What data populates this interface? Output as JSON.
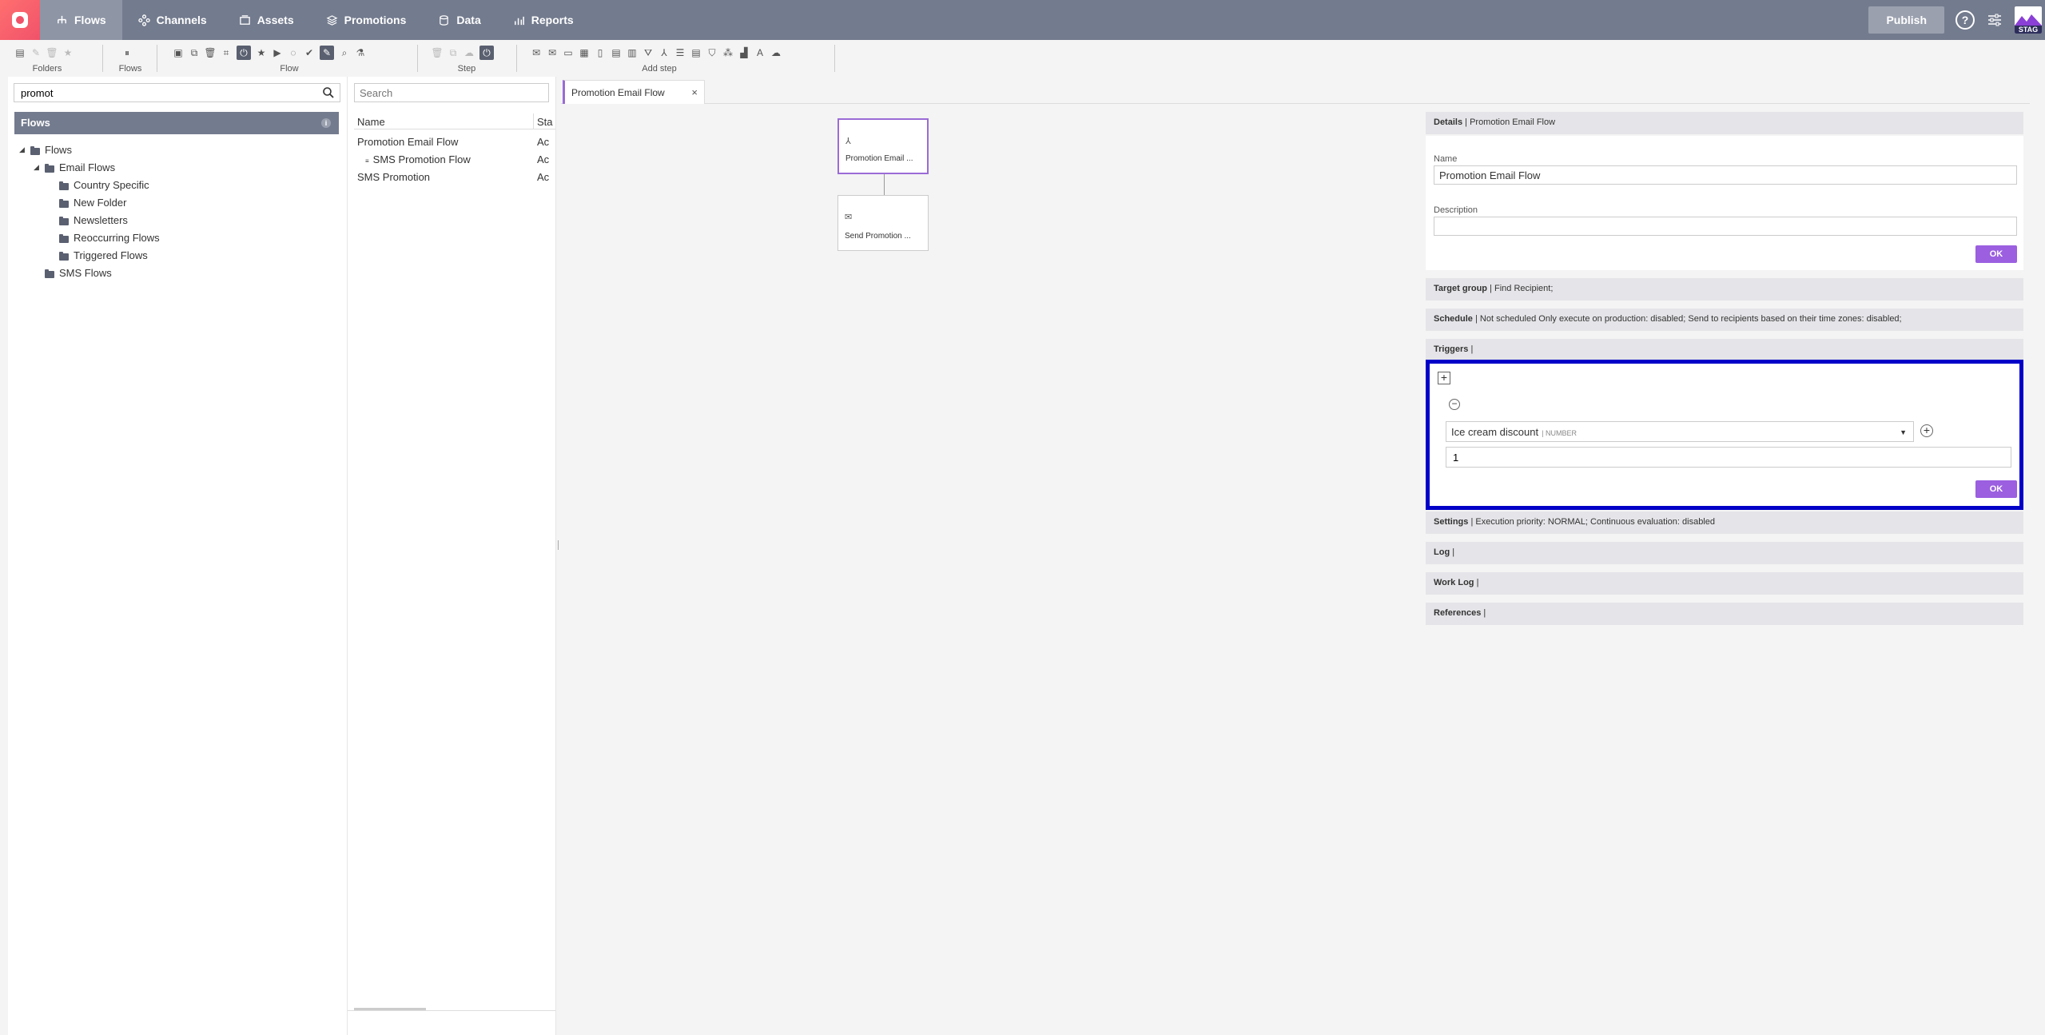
{
  "nav": {
    "items": [
      {
        "label": "Flows",
        "icon": "flows-icon"
      },
      {
        "label": "Channels",
        "icon": "channels-icon"
      },
      {
        "label": "Assets",
        "icon": "assets-icon"
      },
      {
        "label": "Promotions",
        "icon": "promotions-icon"
      },
      {
        "label": "Data",
        "icon": "data-icon"
      },
      {
        "label": "Reports",
        "icon": "reports-icon"
      }
    ],
    "publish_label": "Publish",
    "help_label": "?",
    "env_label": "STAG",
    "accent": "#737b8e"
  },
  "toolbar": {
    "groups": [
      {
        "label": "Folders"
      },
      {
        "label": "Flows"
      },
      {
        "label": "Flow"
      },
      {
        "label": "Step"
      },
      {
        "label": "Add step"
      }
    ]
  },
  "tree": {
    "search_value": "promot",
    "header": "Flows",
    "info_label": "i",
    "nodes": [
      {
        "label": "Flows"
      },
      {
        "label": "Email Flows"
      },
      {
        "label": "Country Specific"
      },
      {
        "label": "New Folder"
      },
      {
        "label": "Newsletters"
      },
      {
        "label": "Reoccurring Flows"
      },
      {
        "label": "Triggered Flows"
      },
      {
        "label": "SMS Flows"
      }
    ]
  },
  "list": {
    "search_placeholder": "Search",
    "columns": [
      "Name",
      "Sta"
    ],
    "rows": [
      {
        "name": "Promotion Email Flow",
        "status": "Ac"
      },
      {
        "name": "SMS Promotion Flow",
        "status": "Ac"
      },
      {
        "name": "SMS Promotion",
        "status": "Ac"
      }
    ]
  },
  "editor": {
    "tab_label": "Promotion Email Flow",
    "tab_close": "×",
    "nodes": [
      {
        "label": "Promotion Email ..."
      },
      {
        "label": "Send Promotion ..."
      }
    ]
  },
  "details": {
    "header_title": "Details",
    "header_value": "Promotion Email Flow",
    "name_label": "Name",
    "name_value": "Promotion Email Flow",
    "description_label": "Description",
    "description_value": "",
    "ok_label": "OK",
    "target_title": "Target group",
    "target_value": "Find Recipient;",
    "schedule_title": "Schedule",
    "schedule_value": "Not scheduled Only execute on production: disabled; Send to recipients based on their time zones: disabled;",
    "triggers_title": "Triggers",
    "trigger_field": "Ice cream discount",
    "trigger_type": "NUMBER",
    "trigger_value": "1",
    "settings_title": "Settings",
    "settings_value": "Execution priority: NORMAL; Continuous evaluation: disabled",
    "log_title": "Log",
    "worklog_title": "Work Log",
    "references_title": "References",
    "ok_color": "#9b5fe0",
    "highlight_color": "#0000c8"
  }
}
